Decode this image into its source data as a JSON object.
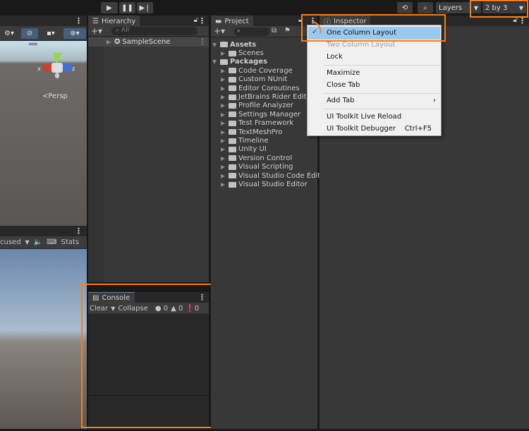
{
  "toolbar": {
    "play_icon": "play-icon",
    "pause_icon": "pause-icon",
    "step_icon": "step-icon",
    "layers_label": "Layers",
    "layout_label": "2 by 3"
  },
  "scene": {
    "persp_label": "<Persp",
    "axes": {
      "x": "x",
      "y": "y",
      "z": "z"
    }
  },
  "game": {
    "focus_label": "cused",
    "stats_label": "Stats"
  },
  "hierarchy": {
    "tab": "Hierarchy",
    "search_placeholder": "All",
    "items": [
      {
        "label": "SampleScene"
      }
    ]
  },
  "console": {
    "tab": "Console",
    "clear": "Clear",
    "collapse": "Collapse",
    "log_count": "0",
    "warn_count": "0",
    "error_count": "0"
  },
  "project": {
    "tab": "Project",
    "tree": [
      {
        "label": "Assets",
        "level": 0,
        "bold": true,
        "open": true
      },
      {
        "label": "Scenes",
        "level": 1
      },
      {
        "label": "Packages",
        "level": 0,
        "bold": true,
        "open": true
      },
      {
        "label": "Code Coverage",
        "level": 1
      },
      {
        "label": "Custom NUnit",
        "level": 1
      },
      {
        "label": "Editor Coroutines",
        "level": 1
      },
      {
        "label": "JetBrains Rider Editor",
        "level": 1
      },
      {
        "label": "Profile Analyzer",
        "level": 1
      },
      {
        "label": "Settings Manager",
        "level": 1
      },
      {
        "label": "Test Framework",
        "level": 1
      },
      {
        "label": "TextMeshPro",
        "level": 1
      },
      {
        "label": "Timeline",
        "level": 1
      },
      {
        "label": "Unity UI",
        "level": 1
      },
      {
        "label": "Version Control",
        "level": 1
      },
      {
        "label": "Visual Scripting",
        "level": 1
      },
      {
        "label": "Visual Studio Code Editor",
        "level": 1
      },
      {
        "label": "Visual Studio Editor",
        "level": 1
      }
    ]
  },
  "inspector": {
    "tab": "Inspector"
  },
  "context_menu": {
    "one_column": "One Column Layout",
    "two_column": "Two Column Layout",
    "lock": "Lock",
    "maximize": "Maximize",
    "close_tab": "Close Tab",
    "add_tab": "Add Tab",
    "live_reload": "UI Toolkit Live Reload",
    "debugger": "UI Toolkit Debugger",
    "debugger_shortcut": "Ctrl+F5"
  },
  "colors": {
    "highlight": "#99c9ef",
    "annotation": "#f47f20"
  }
}
